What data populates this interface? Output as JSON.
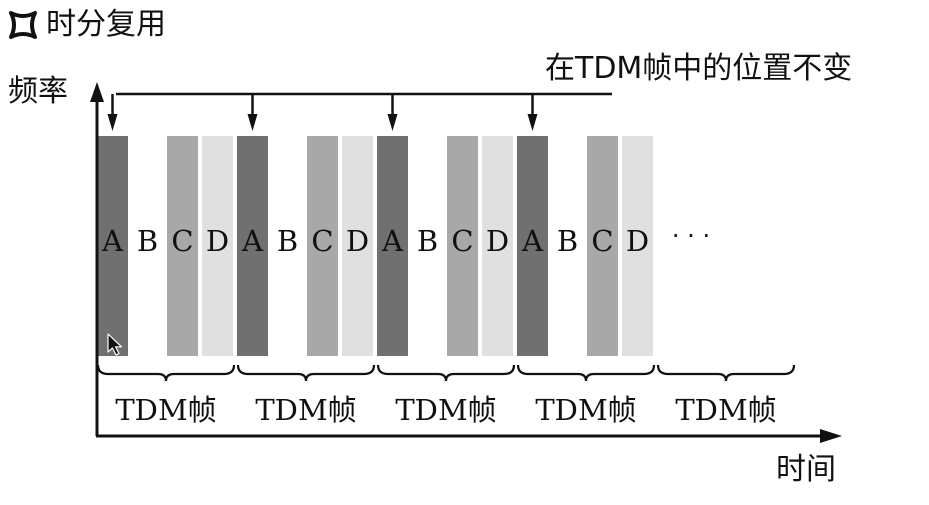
{
  "header": {
    "title": "时分复用",
    "bullet_icon": "hollow-circle-bullet-icon"
  },
  "diagram": {
    "annotation": "在TDM帧中的位置不变",
    "y_axis_label": "频率",
    "x_axis_label": "时间",
    "slots": [
      "A",
      "B",
      "C",
      "D",
      "A",
      "B",
      "C",
      "D",
      "A",
      "B",
      "C",
      "D",
      "A",
      "B",
      "C",
      "D"
    ],
    "slot_colors": {
      "A": "#707070",
      "B": "#ffffff",
      "C": "#a8a8a8",
      "D": "#e0e0e0"
    },
    "ellipsis": "· · ·",
    "frames": [
      "TDM帧",
      "TDM帧",
      "TDM帧",
      "TDM帧",
      "TDM帧"
    ],
    "pointer_icon": "mouse-pointer-icon"
  }
}
